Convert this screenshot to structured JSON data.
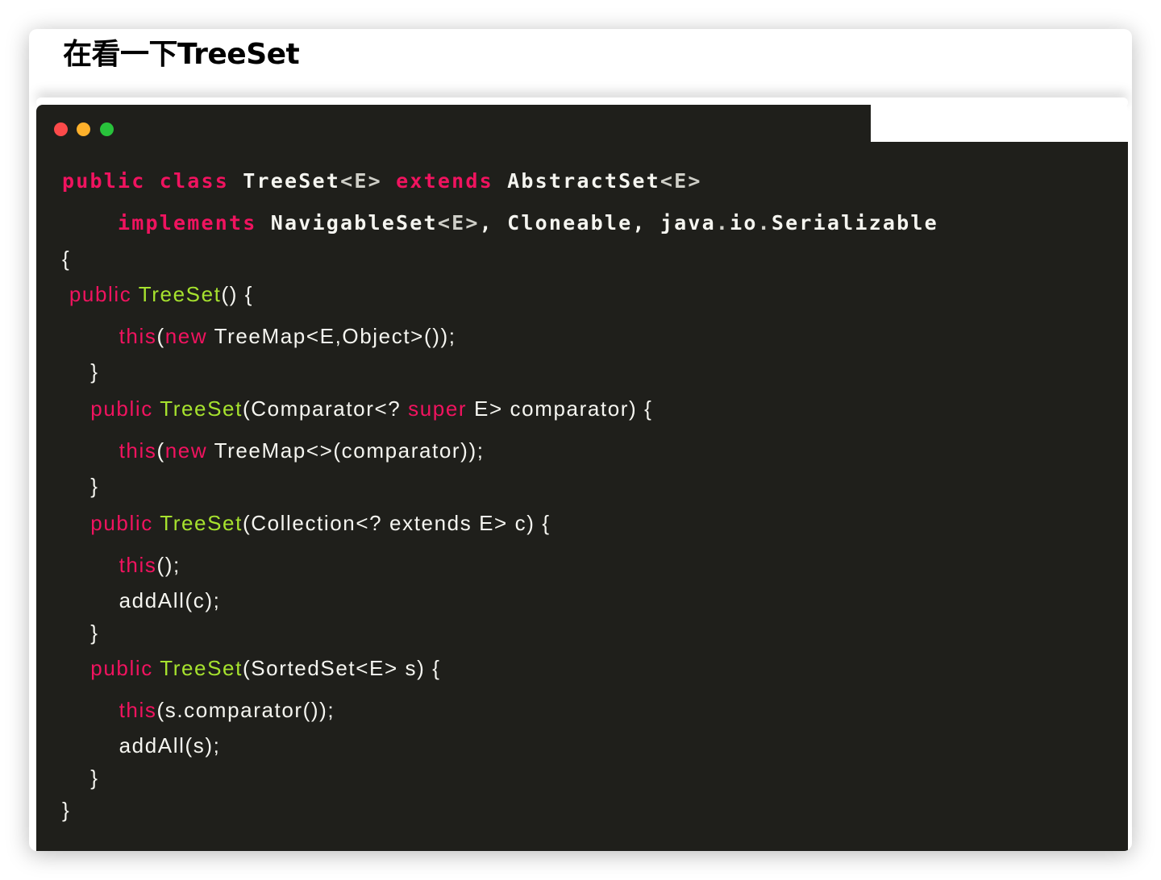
{
  "page": {
    "title": "在看一下TreeSet"
  },
  "window": {
    "controls": [
      {
        "name": "close",
        "color": "#fc4a4a"
      },
      {
        "name": "minimize",
        "color": "#fdb02b"
      },
      {
        "name": "maximize",
        "color": "#28c23b"
      }
    ]
  },
  "theme": {
    "background": "#1f1f1b",
    "keyword": "#f0135f",
    "function": "#a6e22e",
    "text": "#f0f0ea"
  },
  "code": {
    "language": "java",
    "lines": [
      {
        "style": "bold",
        "tokens": [
          {
            "t": "public",
            "c": "kw"
          },
          {
            "t": " ",
            "c": "plain"
          },
          {
            "t": "class",
            "c": "kw"
          },
          {
            "t": " TreeSet",
            "c": "plain"
          },
          {
            "t": "<E>",
            "c": "pt"
          },
          {
            "t": " ",
            "c": "plain"
          },
          {
            "t": "extends",
            "c": "kw"
          },
          {
            "t": " AbstractSet",
            "c": "plain"
          },
          {
            "t": "<E>",
            "c": "pt"
          }
        ]
      },
      {
        "style": "bold",
        "tokens": [
          {
            "t": "    ",
            "c": "plain"
          },
          {
            "t": "implements",
            "c": "kw"
          },
          {
            "t": " NavigableSet",
            "c": "plain"
          },
          {
            "t": "<E>",
            "c": "pt"
          },
          {
            "t": ", Cloneable, java",
            "c": "plain"
          },
          {
            "t": ".",
            "c": "pt"
          },
          {
            "t": "io",
            "c": "plain"
          },
          {
            "t": ".",
            "c": "pt"
          },
          {
            "t": "Serializable",
            "c": "plain"
          }
        ]
      },
      {
        "style": "light",
        "tokens": [
          {
            "t": "{",
            "c": "plain"
          }
        ]
      },
      {
        "style": "light",
        "tokens": [
          {
            "t": " ",
            "c": "plain"
          },
          {
            "t": "public",
            "c": "kw"
          },
          {
            "t": " ",
            "c": "plain"
          },
          {
            "t": "TreeSet",
            "c": "fn"
          },
          {
            "t": "() {",
            "c": "plain"
          }
        ]
      },
      {
        "style": "light",
        "tokens": [
          {
            "t": "        ",
            "c": "plain"
          },
          {
            "t": "this",
            "c": "kw"
          },
          {
            "t": "(",
            "c": "plain"
          },
          {
            "t": "new",
            "c": "kw"
          },
          {
            "t": " TreeMap<E,Object>());",
            "c": "plain"
          }
        ]
      },
      {
        "style": "light",
        "tokens": [
          {
            "t": "    }",
            "c": "plain"
          }
        ]
      },
      {
        "style": "light",
        "tokens": [
          {
            "t": "    ",
            "c": "plain"
          },
          {
            "t": "public",
            "c": "kw"
          },
          {
            "t": " ",
            "c": "plain"
          },
          {
            "t": "TreeSet",
            "c": "fn"
          },
          {
            "t": "(Comparator<? ",
            "c": "plain"
          },
          {
            "t": "super",
            "c": "kw"
          },
          {
            "t": " E> comparator) {",
            "c": "plain"
          }
        ]
      },
      {
        "style": "light",
        "tokens": [
          {
            "t": "        ",
            "c": "plain"
          },
          {
            "t": "this",
            "c": "kw"
          },
          {
            "t": "(",
            "c": "plain"
          },
          {
            "t": "new",
            "c": "kw"
          },
          {
            "t": " TreeMap<>(comparator));",
            "c": "plain"
          }
        ]
      },
      {
        "style": "light",
        "tokens": [
          {
            "t": "    }",
            "c": "plain"
          }
        ]
      },
      {
        "style": "light",
        "tokens": [
          {
            "t": "    ",
            "c": "plain"
          },
          {
            "t": "public",
            "c": "kw"
          },
          {
            "t": " ",
            "c": "plain"
          },
          {
            "t": "TreeSet",
            "c": "fn"
          },
          {
            "t": "(Collection<? extends E> c) {",
            "c": "plain"
          }
        ]
      },
      {
        "style": "light",
        "tokens": [
          {
            "t": "        ",
            "c": "plain"
          },
          {
            "t": "this",
            "c": "kw"
          },
          {
            "t": "();",
            "c": "plain"
          }
        ]
      },
      {
        "style": "light",
        "tokens": [
          {
            "t": "        addAll(c);",
            "c": "plain"
          }
        ]
      },
      {
        "style": "light",
        "tokens": [
          {
            "t": "    }",
            "c": "plain"
          }
        ]
      },
      {
        "style": "light",
        "tokens": [
          {
            "t": "    ",
            "c": "plain"
          },
          {
            "t": "public",
            "c": "kw"
          },
          {
            "t": " ",
            "c": "plain"
          },
          {
            "t": "TreeSet",
            "c": "fn"
          },
          {
            "t": "(SortedSet<E> s) {",
            "c": "plain"
          }
        ]
      },
      {
        "style": "light",
        "tokens": [
          {
            "t": "        ",
            "c": "plain"
          },
          {
            "t": "this",
            "c": "kw"
          },
          {
            "t": "(s.comparator());",
            "c": "plain"
          }
        ]
      },
      {
        "style": "light",
        "tokens": [
          {
            "t": "        addAll(s);",
            "c": "plain"
          }
        ]
      },
      {
        "style": "light",
        "tokens": [
          {
            "t": "    }",
            "c": "plain"
          }
        ]
      },
      {
        "style": "light",
        "tokens": [
          {
            "t": "}",
            "c": "plain"
          }
        ]
      }
    ]
  }
}
